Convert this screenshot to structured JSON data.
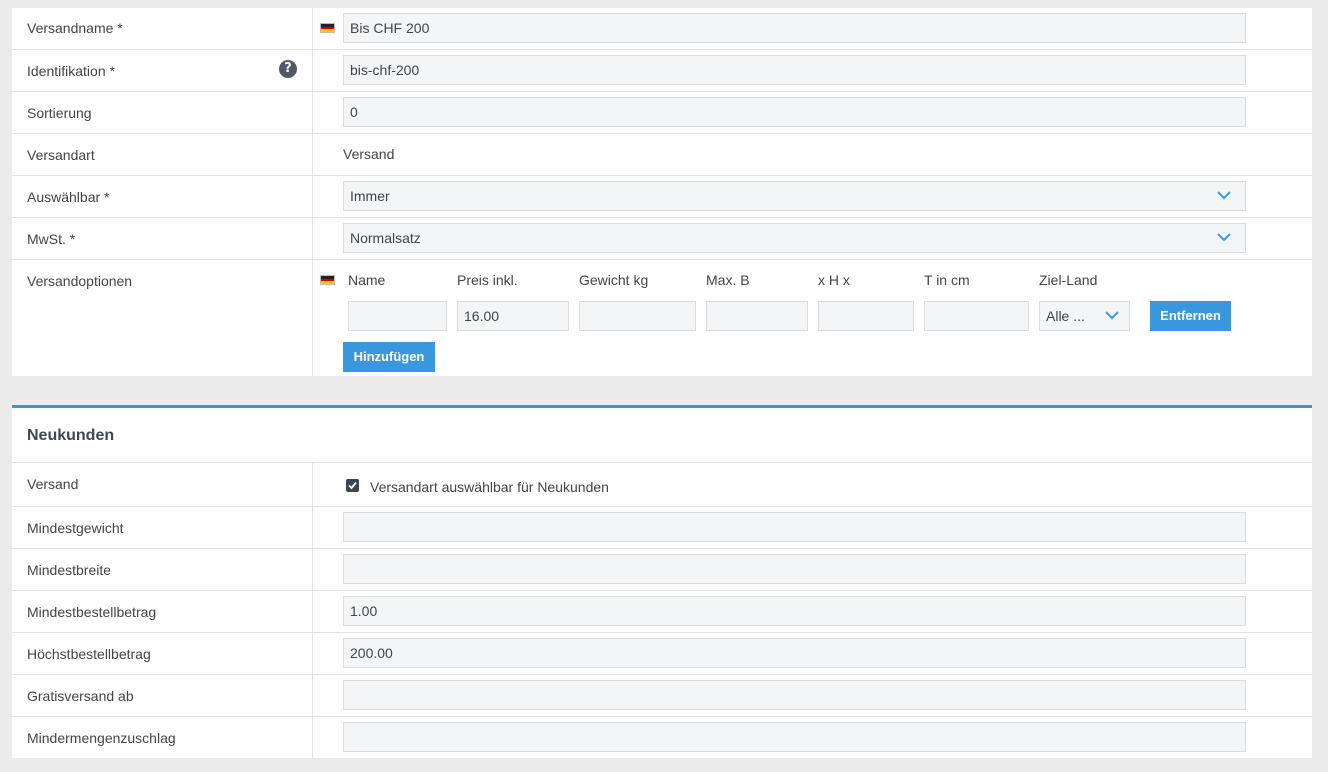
{
  "shipping": {
    "name": {
      "label": "Versandname *",
      "value": "Bis CHF 200"
    },
    "ident": {
      "label": "Identifikation *",
      "value": "bis-chf-200",
      "help": "?"
    },
    "sort": {
      "label": "Sortierung",
      "value": "0"
    },
    "type": {
      "label": "Versandart",
      "value": "Versand"
    },
    "selectable": {
      "label": "Auswählbar *",
      "value": "Immer"
    },
    "vat": {
      "label": "MwSt. *",
      "value": "Normalsatz"
    },
    "options": {
      "label": "Versandoptionen",
      "columns": [
        "Name",
        "Preis inkl.",
        "Gewicht kg",
        "Max. B",
        "x H x",
        "T in cm",
        "Ziel-Land"
      ],
      "row": {
        "name": "",
        "price": "16.00",
        "weight": "",
        "max_b": "",
        "h": "",
        "t": "",
        "country": "Alle ..."
      },
      "remove_label": "Entfernen",
      "add_label": "Hinzufügen"
    }
  },
  "newcustomers": {
    "title": "Neukunden",
    "shipping": {
      "label": "Versand",
      "checkbox_label": "Versandart auswählbar für Neukunden",
      "checked": true
    },
    "min_weight": {
      "label": "Mindestgewicht",
      "value": ""
    },
    "min_width": {
      "label": "Mindestbreite",
      "value": ""
    },
    "min_order": {
      "label": "Mindestbestellbetrag",
      "value": "1.00"
    },
    "max_order": {
      "label": "Höchstbestellbetrag",
      "value": "200.00"
    },
    "free_from": {
      "label": "Gratisversand ab",
      "value": ""
    },
    "surcharge": {
      "label": "Mindermengenzuschlag",
      "value": ""
    }
  },
  "colors": {
    "accent": "#3998dd",
    "panel_border": "#3e95d6",
    "input_bg": "#f4f5f6"
  }
}
